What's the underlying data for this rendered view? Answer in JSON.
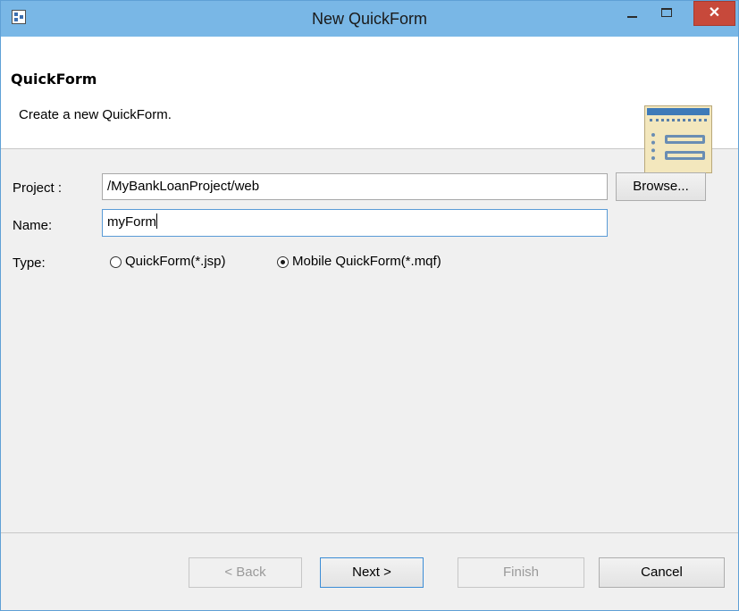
{
  "window": {
    "title": "New QuickForm",
    "close_glyph": "✕"
  },
  "banner": {
    "title": "QuickForm",
    "description": "Create a new QuickForm.",
    "icon": "form-wizard-icon"
  },
  "form": {
    "project_label": "Project :",
    "project_value": "/MyBankLoanProject/web",
    "browse_label": "Browse...",
    "name_label": "Name:",
    "name_value": "myForm",
    "type_label": "Type:",
    "type_options": [
      {
        "label": "QuickForm(*.jsp)",
        "checked": false
      },
      {
        "label": "Mobile QuickForm(*.mqf)",
        "checked": true
      }
    ]
  },
  "footer": {
    "back_label": "< Back",
    "next_label": "Next >",
    "finish_label": "Finish",
    "cancel_label": "Cancel"
  },
  "colors": {
    "titlebar": "#79b7e6",
    "close_button": "#c7493b",
    "focus_border": "#5a9bd6"
  }
}
